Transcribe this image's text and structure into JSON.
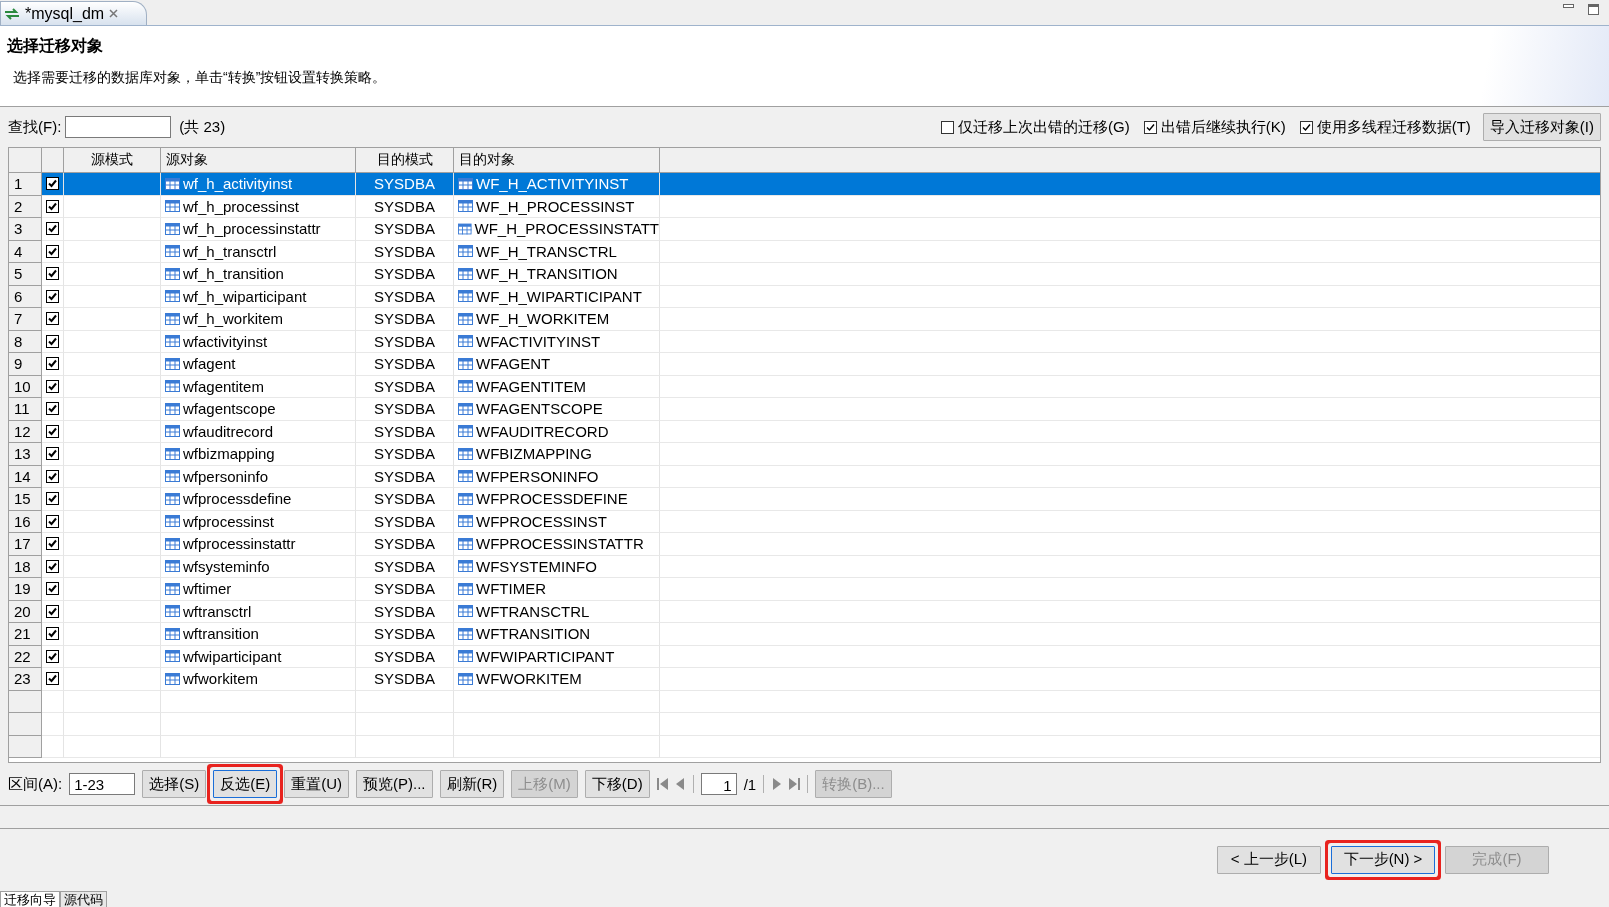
{
  "tab": {
    "title": "*mysql_dm"
  },
  "header": {
    "title": "选择迁移对象",
    "description": "选择需要迁移的数据库对象，单击“转换”按钮设置转换策略。"
  },
  "search": {
    "label": "查找(F):",
    "count": "(共 23)"
  },
  "options": [
    {
      "label": "仅迁移上次出错的迁移(G)",
      "checked": false
    },
    {
      "label": "出错后继续执行(K)",
      "checked": true
    },
    {
      "label": "使用多线程迁移数据(T)",
      "checked": true
    }
  ],
  "import_button": "导入迁移对象(I)",
  "table": {
    "columns": [
      "源模式",
      "源对象",
      "目的模式",
      "目的对象"
    ],
    "rows": [
      {
        "number": "1",
        "checked": true,
        "selected": true,
        "source_object": "wf_h_activityinst",
        "target_schema": "SYSDBA",
        "target_object": "WF_H_ACTIVITYINST"
      },
      {
        "number": "2",
        "checked": true,
        "selected": false,
        "source_object": "wf_h_processinst",
        "target_schema": "SYSDBA",
        "target_object": "WF_H_PROCESSINST"
      },
      {
        "number": "3",
        "checked": true,
        "selected": false,
        "source_object": "wf_h_processinstattr",
        "target_schema": "SYSDBA",
        "target_object": "WF_H_PROCESSINSTATT"
      },
      {
        "number": "4",
        "checked": true,
        "selected": false,
        "source_object": "wf_h_transctrl",
        "target_schema": "SYSDBA",
        "target_object": "WF_H_TRANSCTRL"
      },
      {
        "number": "5",
        "checked": true,
        "selected": false,
        "source_object": "wf_h_transition",
        "target_schema": "SYSDBA",
        "target_object": "WF_H_TRANSITION"
      },
      {
        "number": "6",
        "checked": true,
        "selected": false,
        "source_object": "wf_h_wiparticipant",
        "target_schema": "SYSDBA",
        "target_object": "WF_H_WIPARTICIPANT"
      },
      {
        "number": "7",
        "checked": true,
        "selected": false,
        "source_object": "wf_h_workitem",
        "target_schema": "SYSDBA",
        "target_object": "WF_H_WORKITEM"
      },
      {
        "number": "8",
        "checked": true,
        "selected": false,
        "source_object": "wfactivityinst",
        "target_schema": "SYSDBA",
        "target_object": "WFACTIVITYINST"
      },
      {
        "number": "9",
        "checked": true,
        "selected": false,
        "source_object": "wfagent",
        "target_schema": "SYSDBA",
        "target_object": "WFAGENT"
      },
      {
        "number": "10",
        "checked": true,
        "selected": false,
        "source_object": "wfagentitem",
        "target_schema": "SYSDBA",
        "target_object": "WFAGENTITEM"
      },
      {
        "number": "11",
        "checked": true,
        "selected": false,
        "source_object": "wfagentscope",
        "target_schema": "SYSDBA",
        "target_object": "WFAGENTSCOPE"
      },
      {
        "number": "12",
        "checked": true,
        "selected": false,
        "source_object": "wfauditrecord",
        "target_schema": "SYSDBA",
        "target_object": "WFAUDITRECORD"
      },
      {
        "number": "13",
        "checked": true,
        "selected": false,
        "source_object": "wfbizmapping",
        "target_schema": "SYSDBA",
        "target_object": "WFBIZMAPPING"
      },
      {
        "number": "14",
        "checked": true,
        "selected": false,
        "source_object": "wfpersoninfo",
        "target_schema": "SYSDBA",
        "target_object": "WFPERSONINFO"
      },
      {
        "number": "15",
        "checked": true,
        "selected": false,
        "source_object": "wfprocessdefine",
        "target_schema": "SYSDBA",
        "target_object": "WFPROCESSDEFINE"
      },
      {
        "number": "16",
        "checked": true,
        "selected": false,
        "source_object": "wfprocessinst",
        "target_schema": "SYSDBA",
        "target_object": "WFPROCESSINST"
      },
      {
        "number": "17",
        "checked": true,
        "selected": false,
        "source_object": "wfprocessinstattr",
        "target_schema": "SYSDBA",
        "target_object": "WFPROCESSINSTATTR"
      },
      {
        "number": "18",
        "checked": true,
        "selected": false,
        "source_object": "wfsysteminfo",
        "target_schema": "SYSDBA",
        "target_object": "WFSYSTEMINFO"
      },
      {
        "number": "19",
        "checked": true,
        "selected": false,
        "source_object": "wftimer",
        "target_schema": "SYSDBA",
        "target_object": "WFTIMER"
      },
      {
        "number": "20",
        "checked": true,
        "selected": false,
        "source_object": "wftransctrl",
        "target_schema": "SYSDBA",
        "target_object": "WFTRANSCTRL"
      },
      {
        "number": "21",
        "checked": true,
        "selected": false,
        "source_object": "wftransition",
        "target_schema": "SYSDBA",
        "target_object": "WFTRANSITION"
      },
      {
        "number": "22",
        "checked": true,
        "selected": false,
        "source_object": "wfwiparticipant",
        "target_schema": "SYSDBA",
        "target_object": "WFWIPARTICIPANT"
      },
      {
        "number": "23",
        "checked": true,
        "selected": false,
        "source_object": "wfworkitem",
        "target_schema": "SYSDBA",
        "target_object": "WFWORKITEM"
      }
    ]
  },
  "range": {
    "label": "区间(A):",
    "value": "1-23"
  },
  "actions": [
    {
      "label": "选择(S)",
      "disabled": false,
      "highlighted": false
    },
    {
      "label": "反选(E)",
      "disabled": false,
      "highlighted": true
    },
    {
      "label": "重置(U)",
      "disabled": false,
      "highlighted": false
    },
    {
      "label": "预览(P)...",
      "disabled": false,
      "highlighted": false
    },
    {
      "label": "刷新(R)",
      "disabled": false,
      "highlighted": false
    },
    {
      "label": "上移(M)",
      "disabled": true,
      "highlighted": false
    },
    {
      "label": "下移(D)",
      "disabled": false,
      "highlighted": false
    }
  ],
  "pager": {
    "page": "1",
    "total": "/1"
  },
  "convert_button": {
    "label": "转换(B)...",
    "disabled": true
  },
  "wizard_buttons": [
    {
      "label": "< 上一步(L)",
      "disabled": false,
      "highlighted": false
    },
    {
      "label": "下一步(N) >",
      "disabled": false,
      "highlighted": true
    },
    {
      "label": "完成(F)",
      "disabled": true,
      "highlighted": false
    }
  ],
  "bottom_tabs": [
    {
      "label": "迁移向导",
      "selected": true
    },
    {
      "label": "源代码",
      "selected": false
    }
  ]
}
